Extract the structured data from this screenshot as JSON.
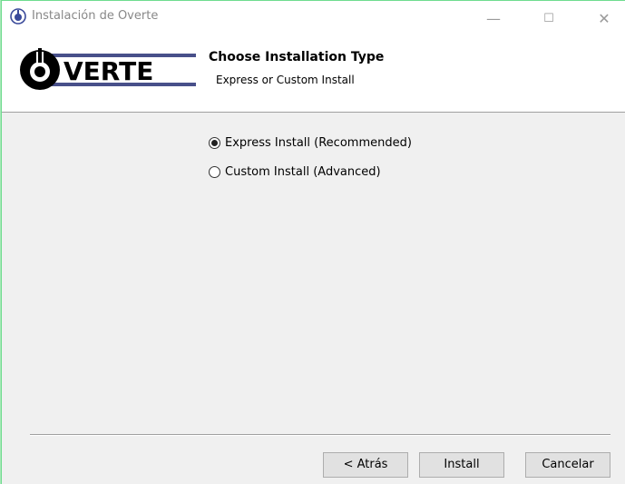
{
  "window": {
    "title": "Instalación de Overte",
    "controls": {
      "minimize": "—",
      "maximize": "☐",
      "close": "✕"
    }
  },
  "header": {
    "title": "Choose Installation Type",
    "subtitle": "Express or Custom Install",
    "logo_text": "VERTE"
  },
  "options": [
    {
      "label": "Express Install (Recommended)",
      "selected": true
    },
    {
      "label": "Custom Install (Advanced)",
      "selected": false
    }
  ],
  "buttons": {
    "back": "< Atrás",
    "install": "Install",
    "cancel": "Cancelar"
  },
  "colors": {
    "accent_border": "#6fdc8f",
    "window_bg": "#f0f0f0",
    "logo_bar": "#48508a"
  }
}
